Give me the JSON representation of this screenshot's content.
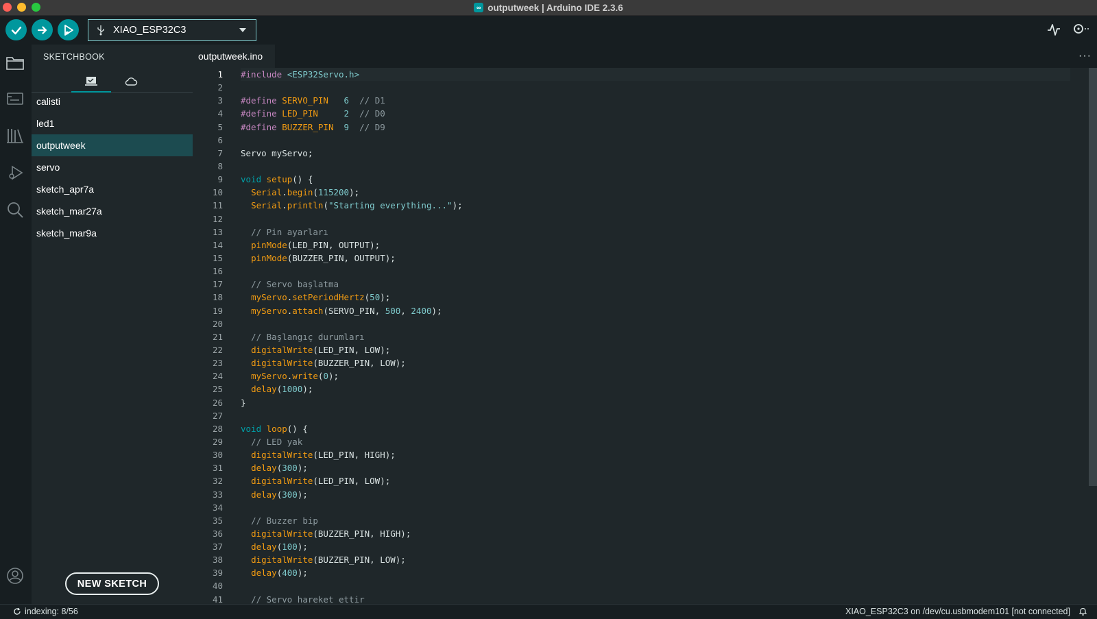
{
  "window": {
    "title": "outputweek | Arduino IDE 2.3.6"
  },
  "toolbar": {
    "board_name": "XIAO_ESP32C3",
    "verify_icon": "checkmark-icon",
    "upload_icon": "arrow-right-icon",
    "debug_icon": "debug-play-icon",
    "usb_icon": "usb-icon",
    "serial_plotter_icon": "pulse-icon",
    "serial_monitor_icon": "magnifier-dots-icon"
  },
  "sidebar": {
    "title": "SKETCHBOOK",
    "tabs": [
      {
        "icon": "laptop-icon",
        "active": true
      },
      {
        "icon": "cloud-icon",
        "active": false
      }
    ],
    "items": [
      {
        "label": "calisti"
      },
      {
        "label": "led1"
      },
      {
        "label": "outputweek",
        "selected": true
      },
      {
        "label": "servo"
      },
      {
        "label": "sketch_apr7a"
      },
      {
        "label": "sketch_mar27a"
      },
      {
        "label": "sketch_mar9a"
      }
    ],
    "new_sketch_label": "NEW SKETCH"
  },
  "activity_bar": [
    "folder-icon",
    "board-manager-icon",
    "library-icon",
    "debug-icon",
    "search-icon",
    "account-icon"
  ],
  "editor": {
    "tab_label": "outputweek.ino",
    "current_line": 1,
    "lines": [
      "#include <ESP32Servo.h>",
      "",
      "#define SERVO_PIN   6  // D1",
      "#define LED_PIN     2  // D0",
      "#define BUZZER_PIN  9  // D9",
      "",
      "Servo myServo;",
      "",
      "void setup() {",
      "  Serial.begin(115200);",
      "  Serial.println(\"Starting everything...\");",
      "",
      "  // Pin ayarları",
      "  pinMode(LED_PIN, OUTPUT);",
      "  pinMode(BUZZER_PIN, OUTPUT);",
      "",
      "  // Servo başlatma",
      "  myServo.setPeriodHertz(50);",
      "  myServo.attach(SERVO_PIN, 500, 2400);",
      "",
      "  // Başlangıç durumları",
      "  digitalWrite(LED_PIN, LOW);",
      "  digitalWrite(BUZZER_PIN, LOW);",
      "  myServo.write(0);",
      "  delay(1000);",
      "}",
      "",
      "void loop() {",
      "  // LED yak",
      "  digitalWrite(LED_PIN, HIGH);",
      "  delay(300);",
      "  digitalWrite(LED_PIN, LOW);",
      "  delay(300);",
      "",
      "  // Buzzer bip",
      "  digitalWrite(BUZZER_PIN, HIGH);",
      "  delay(100);",
      "  digitalWrite(BUZZER_PIN, LOW);",
      "  delay(400);",
      "",
      "  // Servo hareket ettir"
    ]
  },
  "status": {
    "indexing": "indexing: 8/56",
    "connection": "XIAO_ESP32C3 on /dev/cu.usbmodem101 [not connected]"
  },
  "colors": {
    "accent": "#00979d",
    "background": "#1f272a",
    "selection": "#1c4b50"
  }
}
